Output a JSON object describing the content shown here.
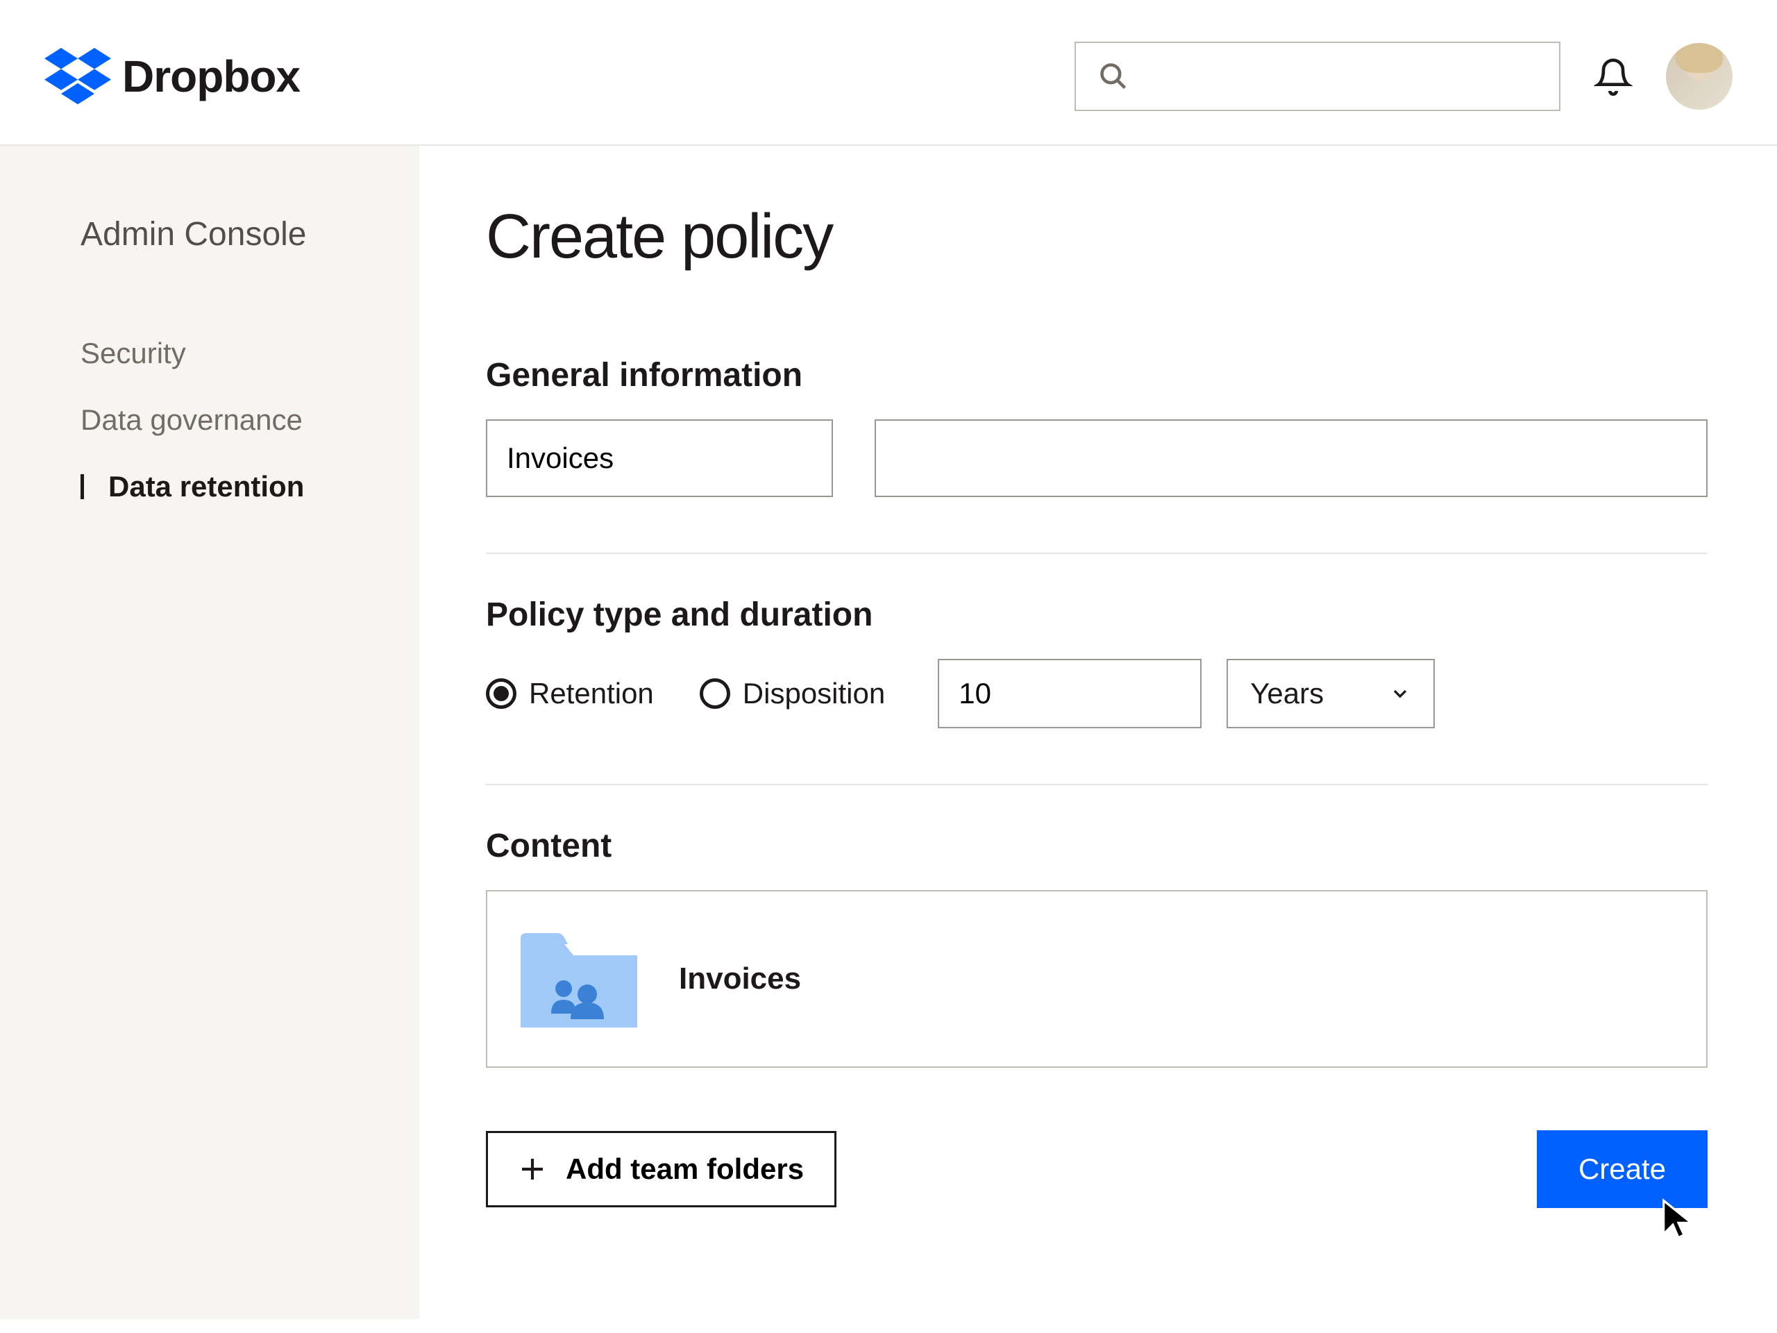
{
  "brand": "Dropbox",
  "header": {
    "search_placeholder": ""
  },
  "sidebar": {
    "title": "Admin Console",
    "items": [
      {
        "label": "Security",
        "active": false
      },
      {
        "label": "Data governance",
        "active": false
      },
      {
        "label": "Data retention",
        "active": true
      }
    ]
  },
  "main": {
    "title": "Create policy",
    "general": {
      "section_title": "General information",
      "name_value": "Invoices",
      "description_value": ""
    },
    "policy": {
      "section_title": "Policy type and duration",
      "options": [
        {
          "label": "Retention",
          "selected": true
        },
        {
          "label": "Disposition",
          "selected": false
        }
      ],
      "duration_value": "10",
      "unit_value": "Years"
    },
    "content": {
      "section_title": "Content",
      "folder_name": "Invoices"
    },
    "actions": {
      "add_folders_label": "Add team folders",
      "create_label": "Create"
    }
  }
}
